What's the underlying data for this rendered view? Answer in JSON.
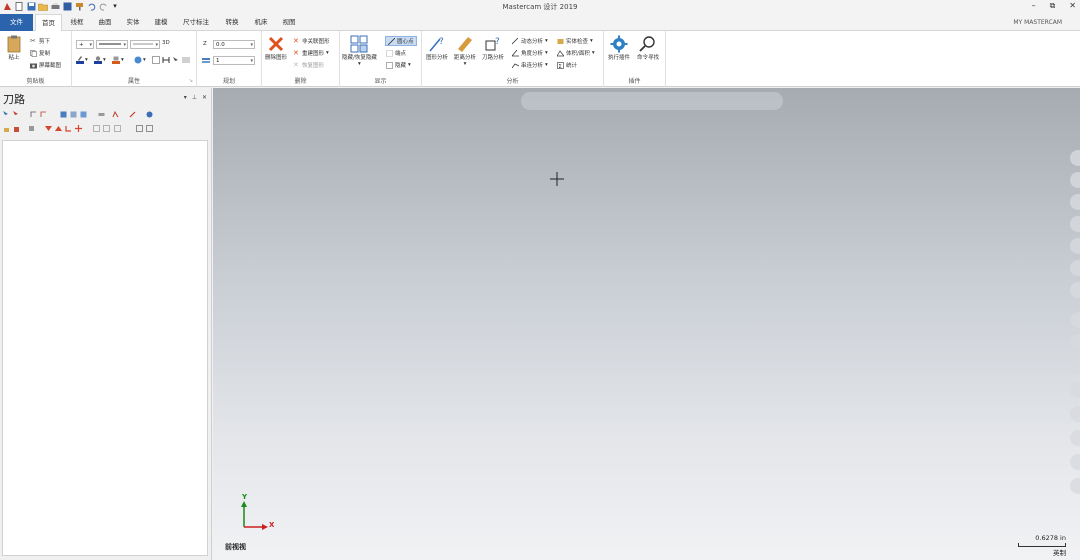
{
  "app": {
    "title": "Mastercam 设计 2019"
  },
  "window_controls": {
    "minimize": "–",
    "restore": "⧉",
    "close": "✕"
  },
  "tabs": [
    {
      "label": "文件"
    },
    {
      "label": "首页"
    },
    {
      "label": "线框"
    },
    {
      "label": "曲面"
    },
    {
      "label": "实体"
    },
    {
      "label": "建模"
    },
    {
      "label": "尺寸标注"
    },
    {
      "label": "转换"
    },
    {
      "label": "机床"
    },
    {
      "label": "视图"
    }
  ],
  "my_mastercam": "MY MASTERCAM",
  "ribbon": {
    "clipboard": {
      "label": "剪贴板",
      "paste": "粘上",
      "cut": "剪下",
      "copy": "复制",
      "screenshot": "屏幕截图"
    },
    "attributes": {
      "label": "属性",
      "3d": "3D"
    },
    "organize": {
      "label": "规划",
      "z_label": "Z",
      "z_value": "0.0",
      "level_value": "1"
    },
    "delete": {
      "label": "删除",
      "delete_entity": "删除图形",
      "delete_dup": "非关联图形",
      "restore_entity": "重建图形",
      "undelete": "恢复图形"
    },
    "display": {
      "label": "显示",
      "hide_unhide": "隐藏/恢复隐藏",
      "center_point": "圆心点",
      "endpoints": "端点",
      "hide": "隐藏"
    },
    "analyze": {
      "label": "分析",
      "entity_analysis": "图形分析",
      "distance_analysis": "距离分析",
      "toolpath_analysis": "刀路分析",
      "dynamic": "动态分析",
      "angle": "角度分析",
      "chain": "串连分析",
      "solid_check": "实体检查",
      "volume_area": "体积/面积",
      "statistics": "统计"
    },
    "addins": {
      "label": "插件",
      "run_addin": "执行插件",
      "command_finder": "命令寻找"
    }
  },
  "left_panel": {
    "title": "刀路"
  },
  "viewport": {
    "view_name": "前视视",
    "scale_value": "0.6278 in",
    "scale_unit": "英制",
    "axis_y": "Y",
    "axis_x": "X"
  },
  "colors": {
    "file_tab": "#2b64ad",
    "axis_x": "#cc2020",
    "axis_y": "#1a8a1a"
  }
}
